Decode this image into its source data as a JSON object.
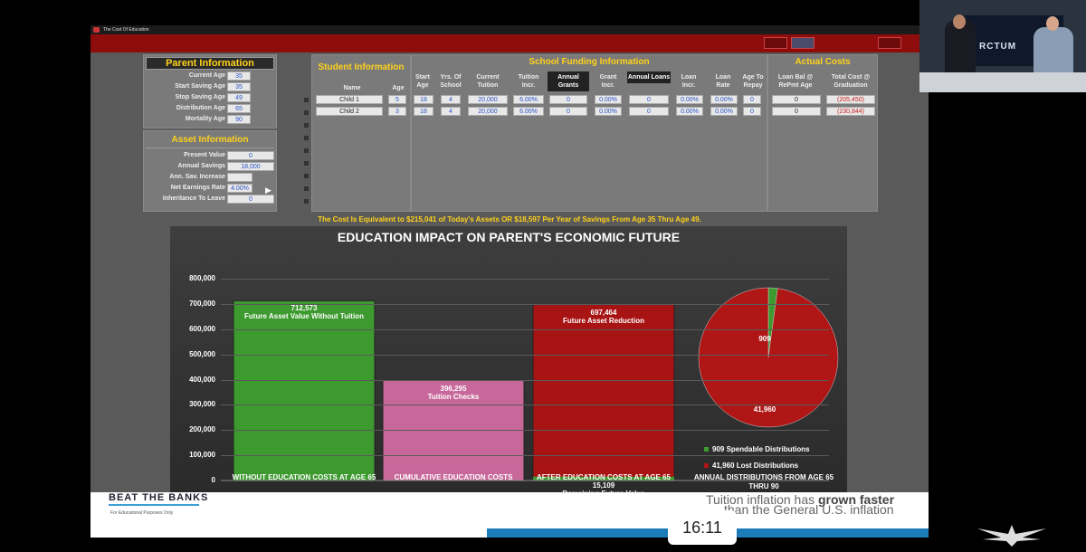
{
  "window": {
    "title": "The Cost Of Education"
  },
  "parent_info": {
    "header": "Parent Information",
    "fields": [
      {
        "label": "Current Age",
        "value": "35"
      },
      {
        "label": "Start Saving Age",
        "value": "35"
      },
      {
        "label": "Stop Saving Age",
        "value": "49"
      },
      {
        "label": "Distribution Age",
        "value": "65"
      },
      {
        "label": "Mortality Age",
        "value": "90"
      }
    ]
  },
  "asset_info": {
    "header": "Asset Information",
    "fields": [
      {
        "label": "Present Value",
        "value": "0"
      },
      {
        "label": "Annual Savings",
        "value": "18,000"
      },
      {
        "label": "Ann. Sav. Increase",
        "value": ""
      },
      {
        "label": "Net Earnings Rate",
        "value": "4.00%"
      },
      {
        "label": "Inheritance To Leave",
        "value": "0"
      }
    ]
  },
  "student_info": {
    "header": "Student Information",
    "col_name": "Name",
    "col_age": "Age",
    "rows": [
      {
        "name": "Child 1",
        "age": "5"
      },
      {
        "name": "Child 2",
        "age": "3"
      }
    ]
  },
  "school_funding": {
    "header": "School Funding Information",
    "columns": [
      "Start Age",
      "Yrs. Of School",
      "Current Tuition",
      "Tuition Incr.",
      "Annual Grants",
      "Grant Incr.",
      "Annual Loans",
      "Loan Incr.",
      "Loan Rate",
      "Age To Repay"
    ],
    "rows": [
      [
        "18",
        "4",
        "20,000",
        "6.00%",
        "0",
        "0.00%",
        "0",
        "0.00%",
        "0.00%",
        "0"
      ],
      [
        "18",
        "4",
        "20,000",
        "6.00%",
        "0",
        "0.00%",
        "0",
        "0.00%",
        "0.00%",
        "0"
      ]
    ]
  },
  "actual_costs": {
    "header": "Actual Costs",
    "columns": [
      "Loan Bal @ RePmt Age",
      "Total Cost @ Graduation"
    ],
    "rows": [
      [
        "0",
        "(205,450)"
      ],
      [
        "0",
        "(230,844)"
      ]
    ]
  },
  "summary": "The Cost Is Equivalent to $215,041 of Today's Assets OR $18,597 Per Year of Savings From Age 35 Thru Age 49.",
  "chart_data": {
    "type": "bar",
    "title": "EDUCATION IMPACT ON PARENT'S ECONOMIC FUTURE",
    "ylim": [
      0,
      800000
    ],
    "yticks": [
      "800,000",
      "700,000",
      "600,000",
      "500,000",
      "400,000",
      "300,000",
      "200,000",
      "100,000",
      "0"
    ],
    "bars": [
      {
        "category": "WITHOUT EDUCATION COSTS AT AGE 65",
        "value": 712573,
        "value_label": "712,573",
        "label": "Future Asset Value Without Tuition",
        "color": "#3c9a2e"
      },
      {
        "category": "CUMULATIVE EDUCATION COSTS",
        "value": 396295,
        "value_label": "396,295",
        "label": "Tuition Checks",
        "color": "#c8689a"
      },
      {
        "category": "AFTER EDUCATION COSTS AT AGE 65",
        "value": 697464,
        "value_label": "697,464",
        "label": "Future Asset Reduction",
        "color": "#a81414",
        "remaining_value": 15109,
        "remaining_label": "15,109",
        "remaining_text": "Remaining Future Value"
      }
    ],
    "pie": {
      "category": "ANNUAL DISTRIBUTIONS FROM AGE 65 THRU 90",
      "slices": [
        {
          "name": "Spendable Distributions",
          "value": 909,
          "label": "909",
          "legend": "909 Spendable Distributions",
          "color": "#3c9a2e"
        },
        {
          "name": "Lost Distributions",
          "value": 41960,
          "label": "41,960",
          "legend": "41,960 Lost Distributions",
          "color": "#b01616"
        }
      ]
    }
  },
  "overlay": {
    "logo": "BEAT THE BANKS",
    "disclaimer": "For Educational Purposes Only",
    "caption_line1_pre": "Tuition inflation has ",
    "caption_line1_bold": "grown faster",
    "caption_line2": "than the General U.S. inflation",
    "timestamp": "16:11"
  },
  "video": {
    "brand": "RCTUM"
  }
}
